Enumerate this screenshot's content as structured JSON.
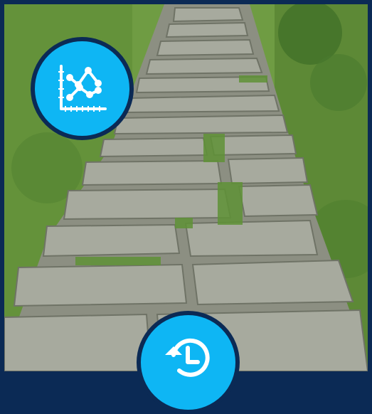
{
  "screen": {
    "background_photo": "stone-steps-path-through-grass",
    "frame_color": "#0b2a55"
  },
  "buttons": {
    "chart": {
      "icon": "line-chart-icon",
      "color": "#0eb6f4"
    },
    "history": {
      "icon": "history-icon",
      "color": "#0eb6f4"
    }
  }
}
